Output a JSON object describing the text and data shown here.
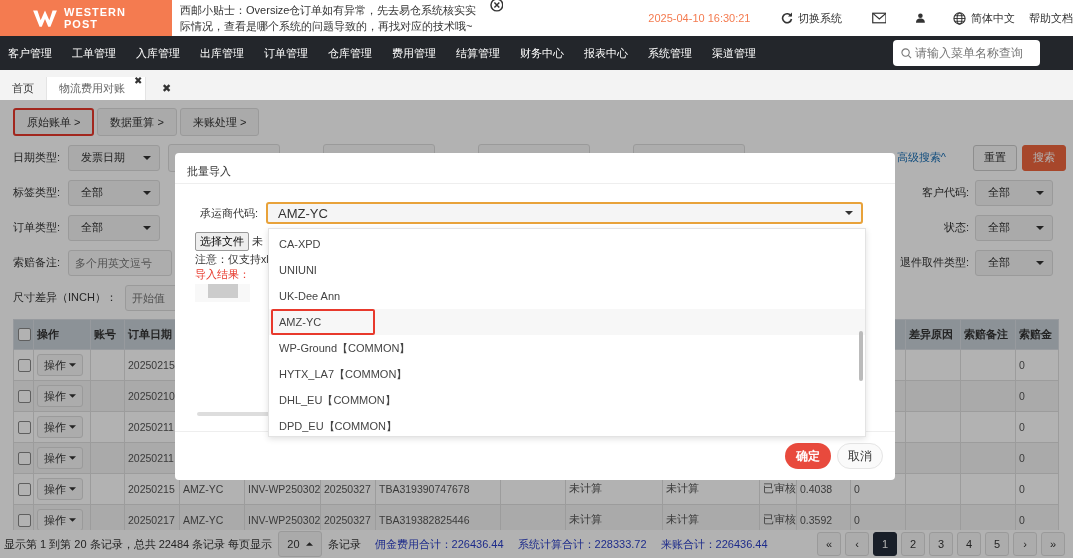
{
  "header": {
    "logo_lines": [
      "WESTERN",
      "POST"
    ],
    "notice": "西邮小贴士：Oversize仓订单如有异常，先去易仓系统核实实际情况，查看是哪个系统的问题导致的，再找对应的技术哦~",
    "datetime": "2025-04-10 16:30:21",
    "switch_system": "切换系统",
    "language": "简体中文",
    "help": "帮助文档"
  },
  "nav": {
    "items": [
      "客户管理",
      "工单管理",
      "入库管理",
      "出库管理",
      "订单管理",
      "仓库管理",
      "费用管理",
      "结算管理",
      "财务中心",
      "报表中心",
      "系统管理",
      "渠道管理"
    ],
    "search_placeholder": "请输入菜单名称查询"
  },
  "tabs": [
    {
      "label": "首页",
      "selected": false
    },
    {
      "label": "物流费用对账",
      "selected": true,
      "close": "✖"
    }
  ],
  "close_all": "✖",
  "steps": [
    {
      "label": "原始账单 >",
      "selected": true
    },
    {
      "label": "数据重算 >",
      "selected": false
    },
    {
      "label": "来账处理 >",
      "selected": false
    }
  ],
  "filters": [
    {
      "label": "日期类型:",
      "kind": "select",
      "value": "发票日期",
      "fields": [
        {
          "kind": "input"
        },
        {
          "kind": "input"
        },
        {
          "kind": "input"
        },
        {
          "kind": "input"
        }
      ],
      "link": "高级搜索^",
      "buttons": [
        {
          "label": "重置",
          "kind": "default"
        },
        {
          "label": "搜索",
          "kind": "primary"
        }
      ]
    },
    {
      "label": "标签类型:",
      "kind": "select",
      "value": "全部",
      "right": {
        "label": "客户代码:",
        "value": "全部"
      }
    },
    {
      "label": "订单类型:",
      "kind": "select",
      "value": "全部",
      "right": {
        "label": "状态:",
        "value": "全部"
      }
    },
    {
      "label": "索赔备注:",
      "kind": "input",
      "placeholder": "多个用英文逗号",
      "right": {
        "label": "退件取件类型:",
        "value": "全部"
      }
    },
    {
      "label": "尺寸差异（INCH）：",
      "kind": "input",
      "placeholder": "开始值"
    }
  ],
  "table": {
    "all_checked": false,
    "columns": {
      "column_1": "操作",
      "column_2": "账号",
      "column_3": "订单日期",
      "column_14": "差异原因",
      "column_15": "索赔备注",
      "column_16": "索赔金"
    },
    "rows": [
      {
        "checked": false,
        "column_1": "操作",
        "column_3": "20250215",
        "column_16": "0"
      },
      {
        "checked": false,
        "column_1": "操作",
        "column_3": "20250210",
        "column_16": "0"
      },
      {
        "checked": false,
        "column_1": "操作",
        "column_3": "20250211",
        "column_16": "0"
      },
      {
        "checked": false,
        "column_1": "操作",
        "column_3": "20250211",
        "column_16": "0"
      },
      {
        "checked": false,
        "column_1": "操作",
        "column_3": "20250215",
        "column_4": "AMZ-YC",
        "column_5": "INV-WP250302",
        "column_6": "20250327",
        "column_7": "TBA319390747678",
        "column_9": "未计算",
        "column_10": "未计算",
        "column_11": "已审核",
        "column_12": "0.4038",
        "column_13": "0",
        "column_16": "0"
      },
      {
        "checked": false,
        "column_1": "操作",
        "column_3": "20250217",
        "column_4": "AMZ-YC",
        "column_5": "INV-WP250302",
        "column_6": "20250327",
        "column_7": "TBA319382825446",
        "column_9": "未计算",
        "column_10": "未计算",
        "column_11": "已审核",
        "column_12": "0.3592",
        "column_13": "0",
        "column_16": "0"
      }
    ]
  },
  "footer": {
    "summary": "显示第 1 到第 20 条记录，总共 22484 条记录 每页显示",
    "page_size": "20",
    "page_size_suffix": "条记录",
    "totals": [
      "佣金费用合计：226436.44",
      "系统计算合计：228333.72",
      "来账合计：226436.44"
    ],
    "pages": [
      {
        "label": "«",
        "selected": false
      },
      {
        "label": "‹",
        "selected": false
      },
      {
        "label": "1",
        "selected": true
      },
      {
        "label": "2",
        "selected": false
      },
      {
        "label": "3",
        "selected": false
      },
      {
        "label": "4",
        "selected": false
      },
      {
        "label": "5",
        "selected": false
      },
      {
        "label": "›",
        "selected": false
      },
      {
        "label": "»",
        "selected": false
      }
    ]
  },
  "modal": {
    "title": "批量导入",
    "carrier_label": "承运商代码:",
    "carrier_value": "AMZ-YC",
    "file_button": "选择文件",
    "file_status": "未",
    "note": "注意：仅支持xl",
    "result_label": "导入结果：",
    "confirm": "确定",
    "cancel": "取消",
    "options": [
      {
        "label": "CA-XPD",
        "selected": false
      },
      {
        "label": "UNIUNI",
        "selected": false
      },
      {
        "label": "UK-Dee Ann",
        "selected": false
      },
      {
        "label": "AMZ-YC",
        "selected": true
      },
      {
        "label": "WP-Ground【COMMON】",
        "selected": false
      },
      {
        "label": "HYTX_LA7【COMMON】",
        "selected": false
      },
      {
        "label": "DHL_EU【COMMON】",
        "selected": false
      },
      {
        "label": "DPD_EU【COMMON】",
        "selected": false
      }
    ]
  }
}
